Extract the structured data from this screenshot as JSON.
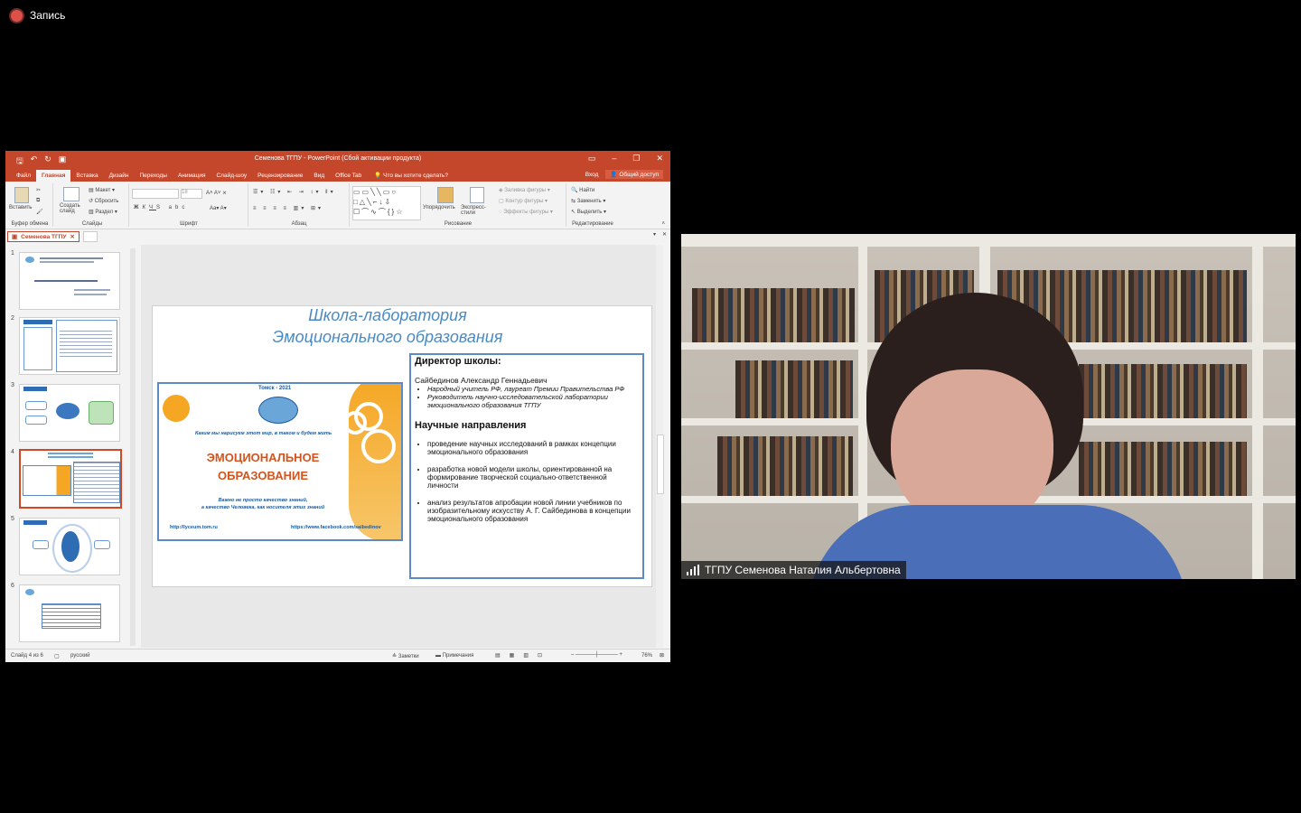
{
  "recording": {
    "label": "Запись"
  },
  "ppt": {
    "window_title": "Семенова ТГПУ - PowerPoint (Сбой активации продукта)",
    "tabs": [
      "Файл",
      "Главная",
      "Вставка",
      "Дизайн",
      "Переходы",
      "Анимация",
      "Слайд-шоу",
      "Рецензирование",
      "Вид",
      "Office Tab"
    ],
    "active_tab": "Главная",
    "tell_me": "Что вы хотите сделать?",
    "signin": "Вход",
    "share": "Общий доступ",
    "ribbon": {
      "paste": "Вставить",
      "clipboard": "Буфер обмена",
      "new_slide": "Создать слайд",
      "layout": "Макет",
      "reset": "Сбросить",
      "section": "Раздел",
      "slides": "Слайды",
      "font_size": "18",
      "font": "Шрифт",
      "paragraph": "Абзац",
      "arrange": "Упорядочить",
      "quick_styles": "Экспресс-стили",
      "drawing": "Рисование",
      "fill": "Заливка фигуры",
      "outline": "Контур фигуры",
      "effects": "Эффекты фигуры",
      "find": "Найти",
      "replace": "Заменить",
      "select": "Выделить",
      "editing": "Редактирование"
    },
    "doc_tab": "Семенова ТГПУ",
    "thumb_numbers": [
      "1",
      "2",
      "3",
      "4",
      "5",
      "6"
    ],
    "slide": {
      "title_line1": "Школа-лаборатория",
      "title_line2": "Эмоционального образования",
      "img_city": "Томск - 2021",
      "img_slogan": "Каким мы нарисуем этот мир, в таком и будем жить",
      "img_main1": "ЭМОЦИОНАЛЬНОЕ",
      "img_main2": "ОБРАЗОВАНИЕ",
      "img_sub1": "Важно не просто качество знаний,",
      "img_sub2": "а качество Человека, как носителя этих знаний",
      "img_link1": "http://lyceum.tom.ru",
      "img_link2": "https://www.facebook.com/saibedinov",
      "director_head": "Директор школы:",
      "director_name": "Сайбединов Александр Геннадьевич",
      "dir_b1": "Народный учитель РФ, лауреат Премии Правительства РФ",
      "dir_b2": "Руководитель научно-исследовательской лаборатории эмоционального образования ТГПУ",
      "sci_head": "Научные направления",
      "sci_b1": "проведение научных исследований в рамках концепции эмоционального образования",
      "sci_b2": "разработка новой модели школы, ориентированной на формирование творческой социально-ответственной личности",
      "sci_b3": "анализ результатов апробации новой линии учебников по изобразительному искусству А. Г. Сайбединова в концепции эмоционального образования"
    },
    "status": {
      "slide_info": "Слайд 4 из 6",
      "language": "русский",
      "notes": "Заметки",
      "comments": "Примечания",
      "zoom": "76%"
    }
  },
  "video": {
    "participant": "ТГПУ Семенова Наталия Альбертовна"
  }
}
